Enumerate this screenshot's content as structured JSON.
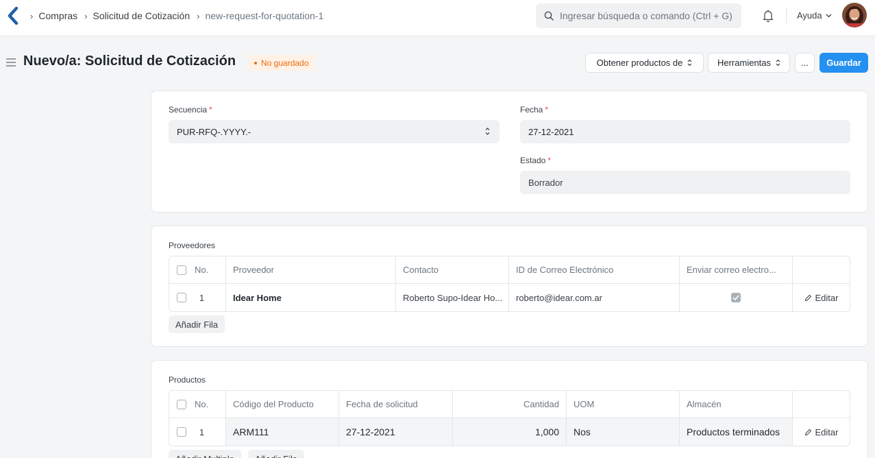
{
  "navbar": {
    "breadcrumbs": [
      "Compras",
      "Solicitud de Cotización",
      "new-request-for-quotation-1"
    ],
    "search_placeholder": "Ingresar búsqueda o comando (Ctrl + G)",
    "help_label": "Ayuda"
  },
  "page": {
    "title": "Nuevo/a: Solicitud de Cotización",
    "status": "No guardado",
    "status_color": "#e86c13",
    "actions": {
      "get_items": "Obtener productos de",
      "tools": "Herramientas",
      "more": "...",
      "save": "Guardar"
    },
    "accent": "#2490ef"
  },
  "form": {
    "series": {
      "label": "Secuencia",
      "value": "PUR-RFQ-.YYYY.-"
    },
    "date": {
      "label": "Fecha",
      "value": "27-12-2021"
    },
    "status": {
      "label": "Estado",
      "value": "Borrador"
    }
  },
  "suppliers": {
    "section_label": "Proveedores",
    "columns": [
      "No.",
      "Proveedor",
      "Contacto",
      "ID de Correo Electrónico",
      "Enviar correo electro..."
    ],
    "rows": [
      {
        "no": "1",
        "supplier": "Idear Home",
        "contact": "Roberto Supo-Idear Ho...",
        "email": "roberto@idear.com.ar",
        "send_email": true,
        "edit": "Editar"
      }
    ],
    "add_row": "Añadir Fila"
  },
  "items": {
    "section_label": "Productos",
    "columns": [
      "No.",
      "Código del Producto",
      "Fecha de solicitud",
      "Cantidad",
      "UOM",
      "Almacén"
    ],
    "rows": [
      {
        "no": "1",
        "item_code": "ARM111",
        "schedule_date": "27-12-2021",
        "qty": "1,000",
        "uom": "Nos",
        "warehouse": "Productos terminados",
        "edit": "Editar"
      }
    ],
    "add_multiple": "Añadir Multiple",
    "add_row": "Añadir Fila"
  }
}
